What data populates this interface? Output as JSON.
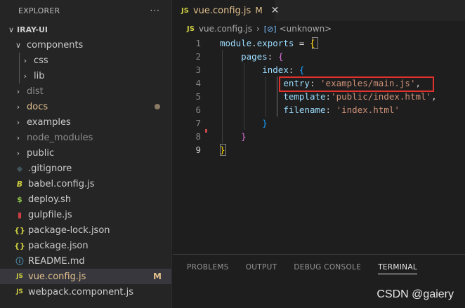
{
  "explorer": {
    "title": "EXPLORER",
    "more": "···",
    "root": "IRAY-UI",
    "items": [
      {
        "label": "components",
        "chev": "∨",
        "icon": ""
      },
      {
        "label": "css",
        "chev": "›",
        "icon": ""
      },
      {
        "label": "lib",
        "chev": "›",
        "icon": ""
      },
      {
        "label": "dist",
        "chev": "›",
        "icon": ""
      },
      {
        "label": "docs",
        "chev": "›",
        "icon": ""
      },
      {
        "label": "examples",
        "chev": "›",
        "icon": ""
      },
      {
        "label": "node_modules",
        "chev": "›",
        "icon": ""
      },
      {
        "label": "public",
        "chev": "›",
        "icon": ""
      },
      {
        "label": ".gitignore",
        "chev": "",
        "icon": "◆"
      },
      {
        "label": "babel.config.js",
        "chev": "",
        "icon": "B"
      },
      {
        "label": "deploy.sh",
        "chev": "",
        "icon": "$"
      },
      {
        "label": "gulpfile.js",
        "chev": "",
        "icon": "▮"
      },
      {
        "label": "package-lock.json",
        "chev": "",
        "icon": "{}"
      },
      {
        "label": "package.json",
        "chev": "",
        "icon": "{}"
      },
      {
        "label": "README.md",
        "chev": "",
        "icon": "ⓘ"
      },
      {
        "label": "vue.config.js",
        "chev": "",
        "icon": "JS",
        "badge": "M"
      },
      {
        "label": "webpack.component.js",
        "chev": "",
        "icon": "JS"
      }
    ]
  },
  "tab": {
    "icon": "JS",
    "name": "vue.config.js",
    "status": "M",
    "close": "✕"
  },
  "breadcrumb": {
    "icon": "JS",
    "file": "vue.config.js",
    "sep": "›",
    "symbol_icon": "[⊘]",
    "symbol": "<unknown>"
  },
  "code": {
    "line_numbers": [
      "1",
      "2",
      "3",
      "4",
      "5",
      "6",
      "7",
      "8",
      "9"
    ],
    "l1": {
      "a": "module",
      "b": ".",
      "c": "exports",
      "d": " = ",
      "e": "{"
    },
    "l2": {
      "a": "pages",
      "b": ": ",
      "c": "{"
    },
    "l3": {
      "a": "index",
      "b": ": ",
      "c": "{"
    },
    "l4": {
      "a": "entry",
      "b": ": ",
      "c": "'examples/main.js'",
      "d": ","
    },
    "l5": {
      "a": "template",
      "b": ":",
      "c": "'public/index.html'",
      "d": ","
    },
    "l6": {
      "a": "filename",
      "b": ": ",
      "c": "'index.html'"
    },
    "l7": {
      "a": "}"
    },
    "l8": {
      "a": "}"
    },
    "l9": {
      "a": "}"
    }
  },
  "panel": {
    "tabs": [
      "PROBLEMS",
      "OUTPUT",
      "DEBUG CONSOLE",
      "TERMINAL"
    ]
  },
  "watermark": "CSDN @gaiery",
  "colors": {
    "accent_modified": "#e2c08d",
    "highlight_box": "#e0312d",
    "js_icon": "#cbcb41"
  }
}
